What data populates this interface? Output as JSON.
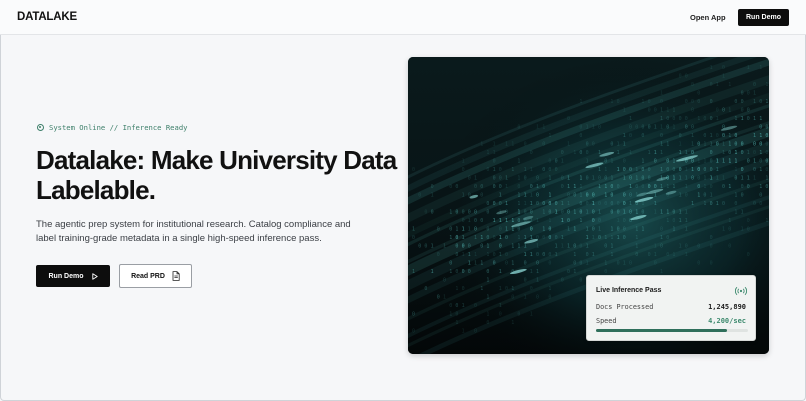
{
  "header": {
    "logo": "DATALAKE",
    "open_app_label": "Open App",
    "run_demo_label": "Run Demo"
  },
  "hero": {
    "status_text": "System Online // Inference Ready",
    "headline": "Datalake: Make University Data Labelable.",
    "description": "The agentic prep system for institutional research. Catalog compliance and label training-grade metadata in a single high-speed inference pass.",
    "primary_button_label": "Run Demo",
    "secondary_button_label": "Read PRD"
  },
  "stats_card": {
    "title": "Live Inference Pass",
    "docs_label": "Docs Processed",
    "docs_value": "1,245,890",
    "speed_label": "Speed",
    "speed_value": "4,200/sec",
    "progress_fraction": 0.86
  },
  "colors": {
    "accent_green": "#3d7f6a",
    "primary_button": "#0d0d0d",
    "panel_bg": "#050b0c",
    "data_teal": "#5fd0cc"
  },
  "icons": {
    "status": "status-ring-icon",
    "play": "play-icon",
    "doc": "document-icon",
    "signal": "broadcast-signal-icon"
  }
}
